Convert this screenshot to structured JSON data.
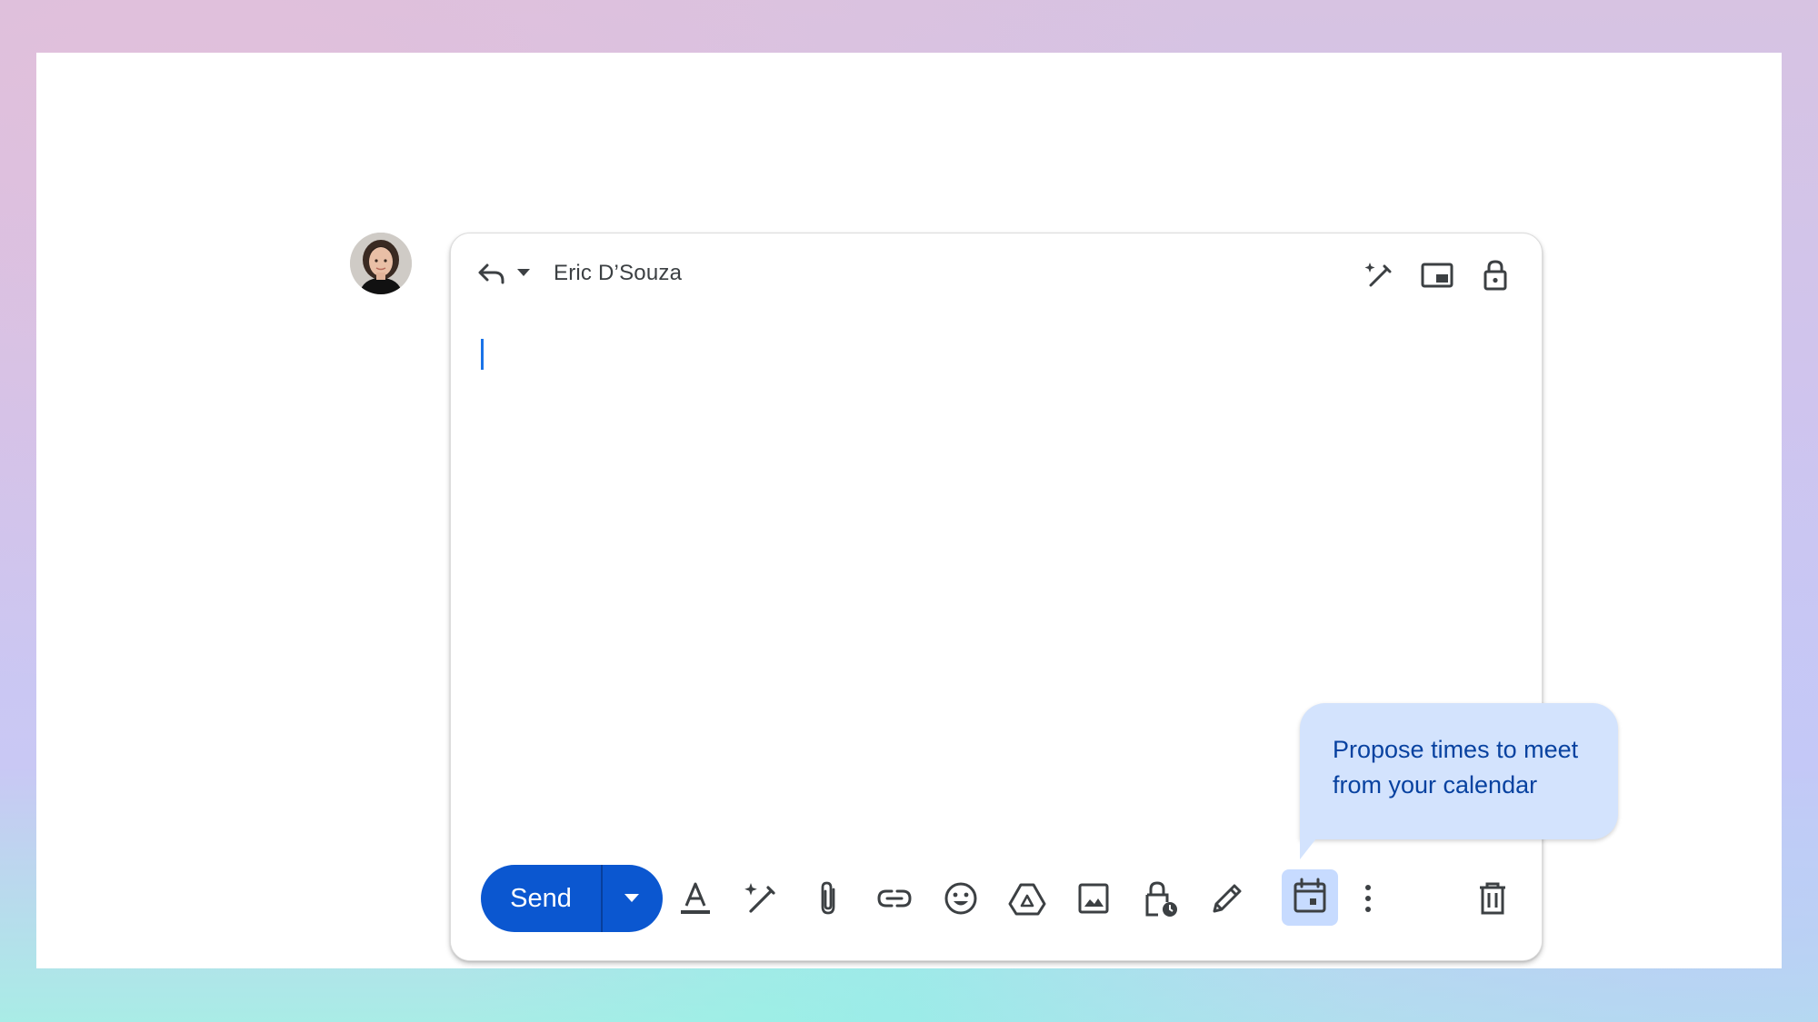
{
  "compose": {
    "recipient": "Eric D’Souza",
    "send_label": "Send"
  },
  "tooltip": {
    "text": "Propose times to meet from your calendar"
  },
  "colors": {
    "send_button": "#0b57d0",
    "tooltip_bg": "#d3e3fd",
    "tooltip_text": "#0842a0",
    "cursor": "#1a73e8",
    "active_icon_bg": "#c7dbff"
  },
  "icons": {
    "header": [
      "reply-icon",
      "chevron-down-icon",
      "magic-pen-icon",
      "pop-out-icon",
      "lock-icon"
    ],
    "toolbar": [
      "format-text-icon",
      "magic-pen-icon",
      "attach-icon",
      "link-icon",
      "emoji-icon",
      "drive-icon",
      "image-icon",
      "confidential-mode-icon",
      "signature-icon",
      "calendar-icon",
      "more-options-icon",
      "trash-icon"
    ]
  }
}
